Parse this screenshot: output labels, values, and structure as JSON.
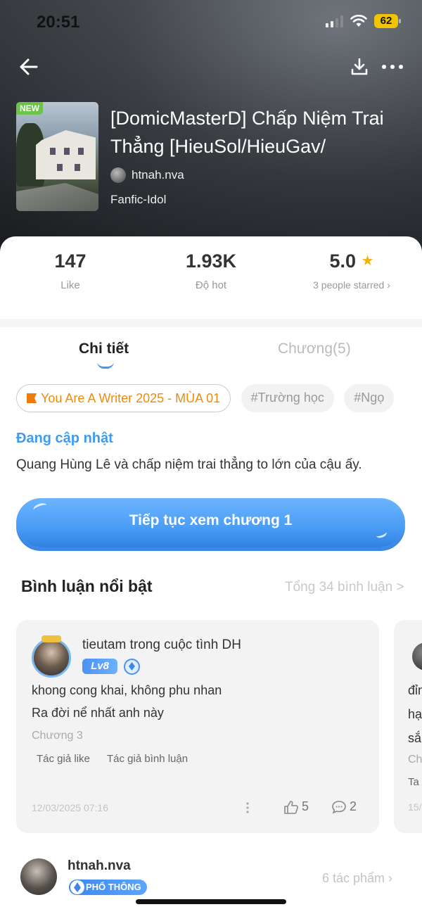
{
  "status_bar": {
    "time": "20:51",
    "battery": "62"
  },
  "book": {
    "badge": "NEW",
    "title": "[DomicMasterD] Chấp Niệm Trai Thẳng [HieuSol/HieuGav/",
    "author": "htnah.nva",
    "genre": "Fanfic-Idol"
  },
  "stats": {
    "likes": "147",
    "likes_label": "Like",
    "hot": "1.93K",
    "hot_label": "Độ hot",
    "rating": "5.0",
    "rating_label": "3 people starred ›"
  },
  "tabs": {
    "detail": "Chi tiết",
    "chapters": "Chương(5)"
  },
  "tags": [
    "You Are A Writer 2025 - MÙA 01",
    "#Trường học",
    "#Ngọ"
  ],
  "update_status": "Đang cập nhật",
  "synopsis": "Quang Hùng Lê và chấp niệm trai thẳng to lớn của cậu ấy.",
  "cta_label": "Tiếp tục xem chương 1",
  "comments": {
    "title": "Bình luận nổi bật",
    "total": "Tổng 34 bình luận >",
    "items": [
      {
        "user": "tieutam trong cuộc tình DH",
        "level": "Lv8",
        "lines": [
          "khong cong khai,  không phu nhan",
          "Ra đời nể nhất anh này"
        ],
        "chapter": "Chương 3",
        "tags": [
          "Tác giả like",
          "Tác giả bình luận"
        ],
        "date": "12/03/2025 07:16",
        "likes": "5",
        "replies": "2"
      }
    ],
    "peek_lines": [
      "đỉn",
      "hạ",
      "sắ",
      "Ch",
      "Ta",
      "15/"
    ]
  },
  "author_footer": {
    "name": "htnah.nva",
    "rank": "PHỔ THÔNG",
    "works": "6 tác phẩm  ›"
  },
  "colors": {
    "accent": "#3f9bf0",
    "event_tag": "#f08a0a",
    "new_badge": "#6cc24a",
    "star": "#f5b400"
  }
}
